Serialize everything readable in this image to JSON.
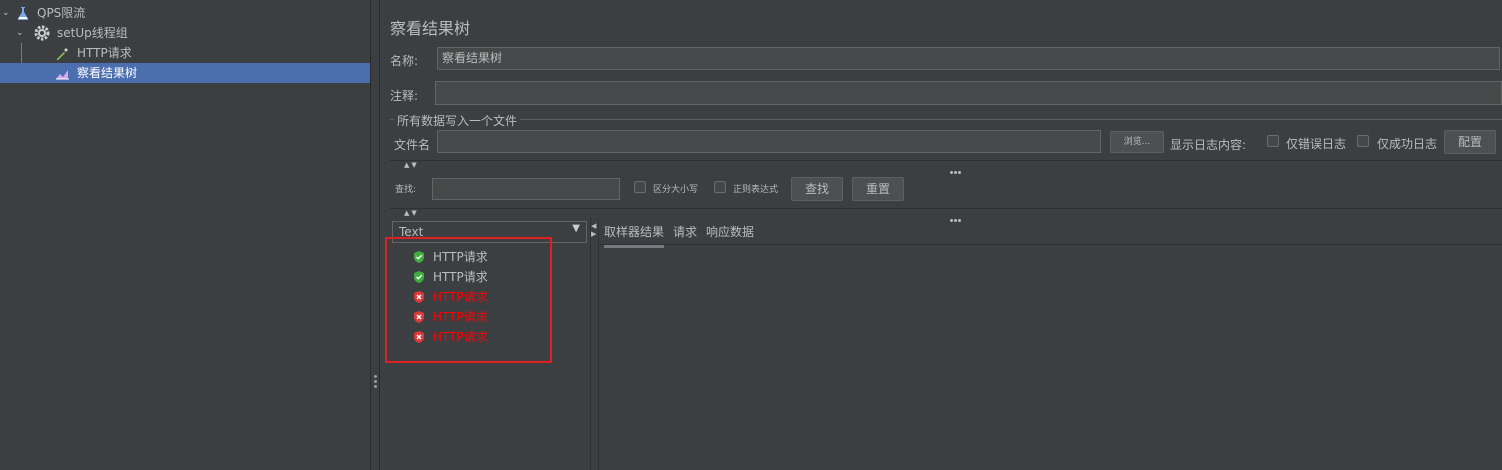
{
  "tree": {
    "items": [
      {
        "label": "QPS限流",
        "icon": "flask-icon",
        "selected": false
      },
      {
        "label": "setUp线程组",
        "icon": "gear-icon",
        "selected": false
      },
      {
        "label": "HTTP请求",
        "icon": "pipette-icon",
        "selected": false
      },
      {
        "label": "察看结果树",
        "icon": "chart-icon",
        "selected": true
      }
    ]
  },
  "panel": {
    "title": "察看结果树",
    "name_label": "名称:",
    "name_value": "察看结果树",
    "comment_label": "注释:",
    "comment_value": "",
    "file_group_label": "所有数据写入一个文件",
    "filename_label": "文件名",
    "filename_value": "",
    "browse_label": "浏览...",
    "log_display_label": "显示日志内容:",
    "errors_only_label": "仅错误日志",
    "success_only_label": "仅成功日志",
    "config_label": "配置"
  },
  "search": {
    "label": "查找:",
    "value": "",
    "case_sensitive_label": "区分大小写",
    "regex_label": "正则表达式",
    "find_label": "查找",
    "reset_label": "重置"
  },
  "results": {
    "renderer": "Text",
    "items": [
      {
        "label": "HTTP请求",
        "status": "success"
      },
      {
        "label": "HTTP请求",
        "status": "success"
      },
      {
        "label": "HTTP请求",
        "status": "error"
      },
      {
        "label": "HTTP请求",
        "status": "error"
      },
      {
        "label": "HTTP请求",
        "status": "error"
      }
    ]
  },
  "tabs": [
    "取样器结果",
    "请求",
    "响应数据"
  ],
  "colors": {
    "background": "#3c3f41",
    "selection": "#4b6eaf",
    "success": "#3fae3f",
    "error": "#ff0000",
    "annotation_box": "#e02020"
  }
}
